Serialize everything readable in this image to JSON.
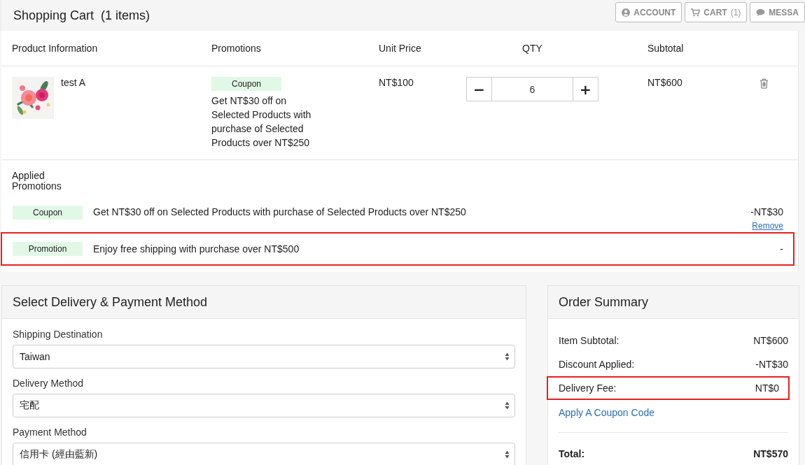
{
  "header": {
    "title": "Shopping Cart",
    "count": "(1 items)",
    "buttons": [
      {
        "kind": "account",
        "label": "ACCOUNT"
      },
      {
        "kind": "cart",
        "label": "CART",
        "count": "(1)"
      },
      {
        "kind": "message",
        "label": "MESSA"
      }
    ]
  },
  "cart": {
    "columns": [
      "Product Information",
      "Promotions",
      "Unit Price",
      "QTY",
      "Subtotal"
    ],
    "items": [
      {
        "name": "test A",
        "promo_tag": "Coupon",
        "promo_text": "Get NT$30 off on Selected Products with purchase of Selected Products over NT$250",
        "unit_price": "NT$100",
        "qty_minus": "−",
        "qty": "6",
        "qty_plus": "+",
        "subtotal": "NT$600"
      }
    ],
    "applied_title": "Applied Promotions",
    "applied": [
      {
        "tag": "Coupon",
        "text": "Get NT$30 off on Selected Products with purchase of Selected Products over NT$250",
        "amount": "-NT$30",
        "link": "Remove",
        "highlighted": false
      },
      {
        "tag": "Promotion",
        "text": "Enjoy free shipping with purchase over NT$500",
        "amount": "-",
        "highlighted": true
      }
    ]
  },
  "delivery": {
    "title": "Select Delivery & Payment Method",
    "fields": [
      {
        "label": "Shipping Destination",
        "value": "Taiwan"
      },
      {
        "label": "Delivery Method",
        "value": "宅配"
      },
      {
        "label": "Payment Method",
        "value": "信用卡 (經由藍新)"
      }
    ]
  },
  "summary": {
    "title": "Order Summary",
    "rows": [
      {
        "label": "Item Subtotal:",
        "value": "NT$600",
        "highlighted": false
      },
      {
        "label": "Discount Applied:",
        "value": "-NT$30",
        "highlighted": false
      },
      {
        "label": "Delivery Fee:",
        "value": "NT$0",
        "highlighted": true
      }
    ],
    "coupon_link": "Apply A Coupon Code",
    "total_label": "Total:",
    "total_value": "NT$570"
  }
}
